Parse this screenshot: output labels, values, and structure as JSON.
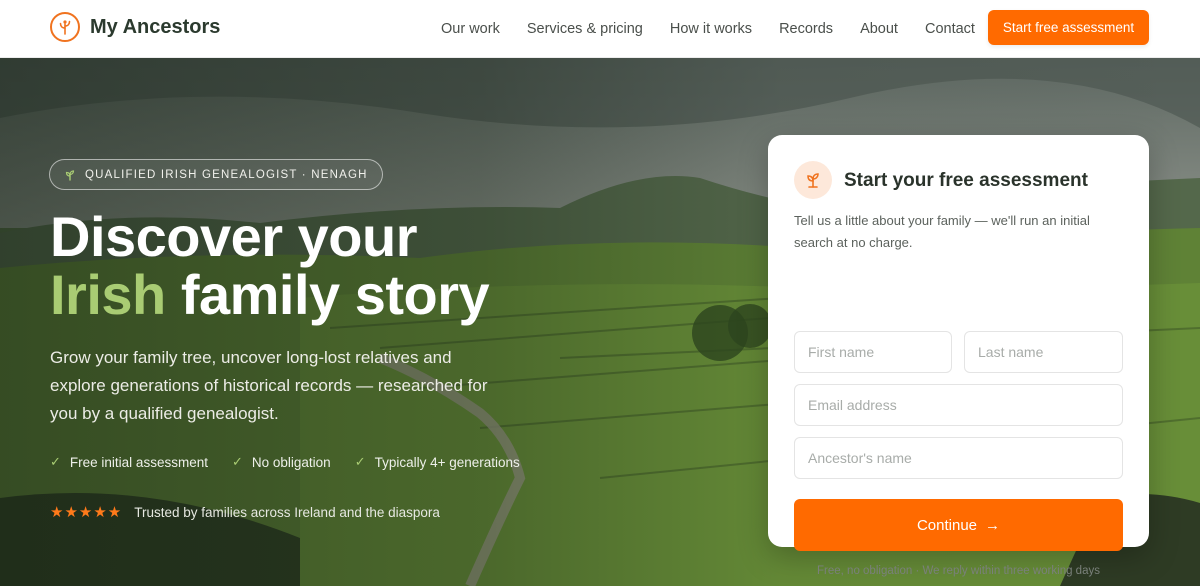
{
  "brand": {
    "name": "My Ancestors",
    "logo_icon": "tree-icon",
    "accent": "#ff6a00",
    "green": "#a9cc73"
  },
  "nav": {
    "links": [
      "Our work",
      "Services & pricing",
      "How it works",
      "Records",
      "About",
      "Contact"
    ],
    "cta": "Start free assessment"
  },
  "hero": {
    "badge": "QUALIFIED IRISH GENEALOGIST · NENAGH",
    "headline_line1": "Discover your",
    "headline_accent": "Irish",
    "headline_line2_rest": " family story",
    "subtitle": "Grow your family tree, uncover long-lost relatives and explore generations of historical records — researched for you by a qualified genealogist.",
    "checks": [
      "Free initial assessment",
      "No obligation",
      "Typically 4+ generations"
    ],
    "stars": "★★★★★",
    "rating": 5,
    "trust": "Trusted by families across Ireland and the diaspora"
  },
  "form": {
    "title": "Start your free assessment",
    "description": "Tell us a little about your family — we'll run an initial search at no charge.",
    "first_name_placeholder": "First name",
    "last_name_placeholder": "Last name",
    "email_placeholder": "Email address",
    "ancestor_placeholder": "Ancestor's name",
    "submit": "Continue",
    "fine_print": "Free, no obligation · We reply within three working days"
  }
}
